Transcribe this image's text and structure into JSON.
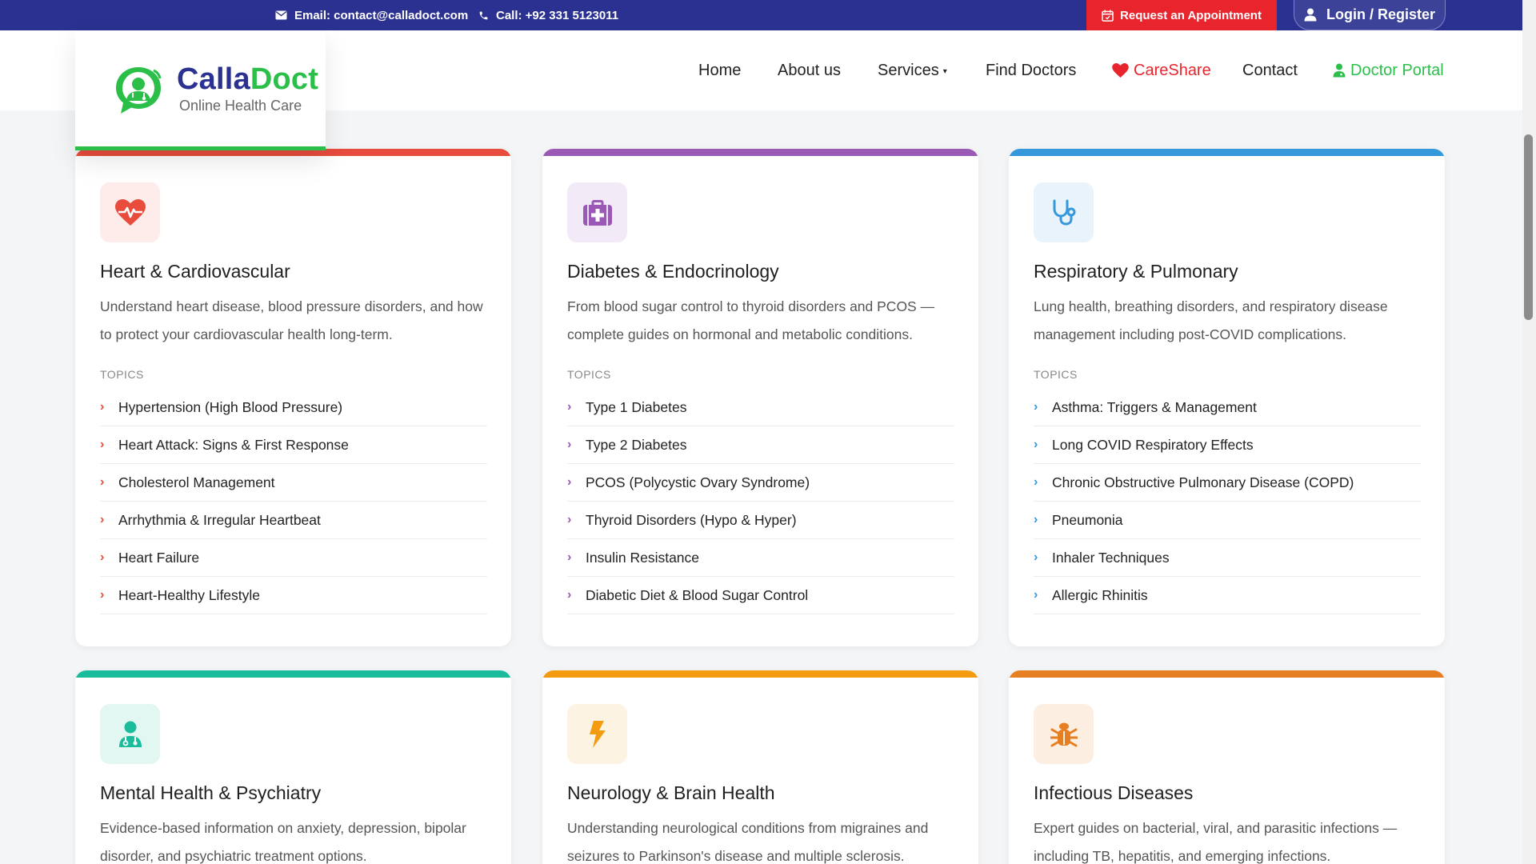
{
  "topbar": {
    "email": "Email: contact@calladoct.com",
    "phone": "Call: +92 331 5123011",
    "appointment_label": "Request an Appointment",
    "login_label": "Login / Register"
  },
  "brand": {
    "name_part1": "Calla",
    "name_part2": "Doct",
    "tagline": "Online Health Care",
    "color_primary": "#2b3190",
    "color_green": "#2bbf4a"
  },
  "nav": {
    "home": "Home",
    "about": "About us",
    "services": "Services",
    "find_doctors": "Find Doctors",
    "careshare": "CareShare",
    "contact": "Contact",
    "doctor_portal": "Doctor Portal"
  },
  "cards": [
    {
      "title": "Heart & Cardiovascular",
      "icon": "heartbeat-icon",
      "accent": "#e74c3c",
      "description": "Understand heart disease, blood pressure disorders, and how to protect your cardiovascular health long-term.",
      "topics_label": "TOPICS",
      "topics": [
        "Hypertension (High Blood Pressure)",
        "Heart Attack: Signs & First Response",
        "Cholesterol Management",
        "Arrhythmia & Irregular Heartbeat",
        "Heart Failure",
        "Heart-Healthy Lifestyle"
      ]
    },
    {
      "title": "Diabetes & Endocrinology",
      "icon": "medical-kit-icon",
      "accent": "#9b59b6",
      "description": "From blood sugar control to thyroid disorders and PCOS — complete guides on hormonal and metabolic conditions.",
      "topics_label": "TOPICS",
      "topics": [
        "Type 1 Diabetes",
        "Type 2 Diabetes",
        "PCOS (Polycystic Ovary Syndrome)",
        "Thyroid Disorders (Hypo & Hyper)",
        "Insulin Resistance",
        "Diabetic Diet & Blood Sugar Control"
      ]
    },
    {
      "title": "Respiratory & Pulmonary",
      "icon": "stethoscope-icon",
      "accent": "#3498db",
      "description": "Lung health, breathing disorders, and respiratory disease management including post-COVID complications.",
      "topics_label": "TOPICS",
      "topics": [
        "Asthma: Triggers & Management",
        "Long COVID Respiratory Effects",
        "Chronic Obstructive Pulmonary Disease (COPD)",
        "Pneumonia",
        "Inhaler Techniques",
        "Allergic Rhinitis"
      ]
    },
    {
      "title": "Mental Health & Psychiatry",
      "icon": "doctor-icon",
      "accent": "#1abc9c",
      "description": "Evidence-based information on anxiety, depression, bipolar disorder, and psychiatric treatment options."
    },
    {
      "title": "Neurology & Brain Health",
      "icon": "bolt-icon",
      "accent": "#f39c12",
      "description": "Understanding neurological conditions from migraines and seizures to Parkinson's disease and multiple sclerosis."
    },
    {
      "title": "Infectious Diseases",
      "icon": "bug-icon",
      "accent": "#e67e22",
      "description": "Expert guides on bacterial, viral, and parasitic infections — including TB, hepatitis, and emerging infections."
    }
  ]
}
